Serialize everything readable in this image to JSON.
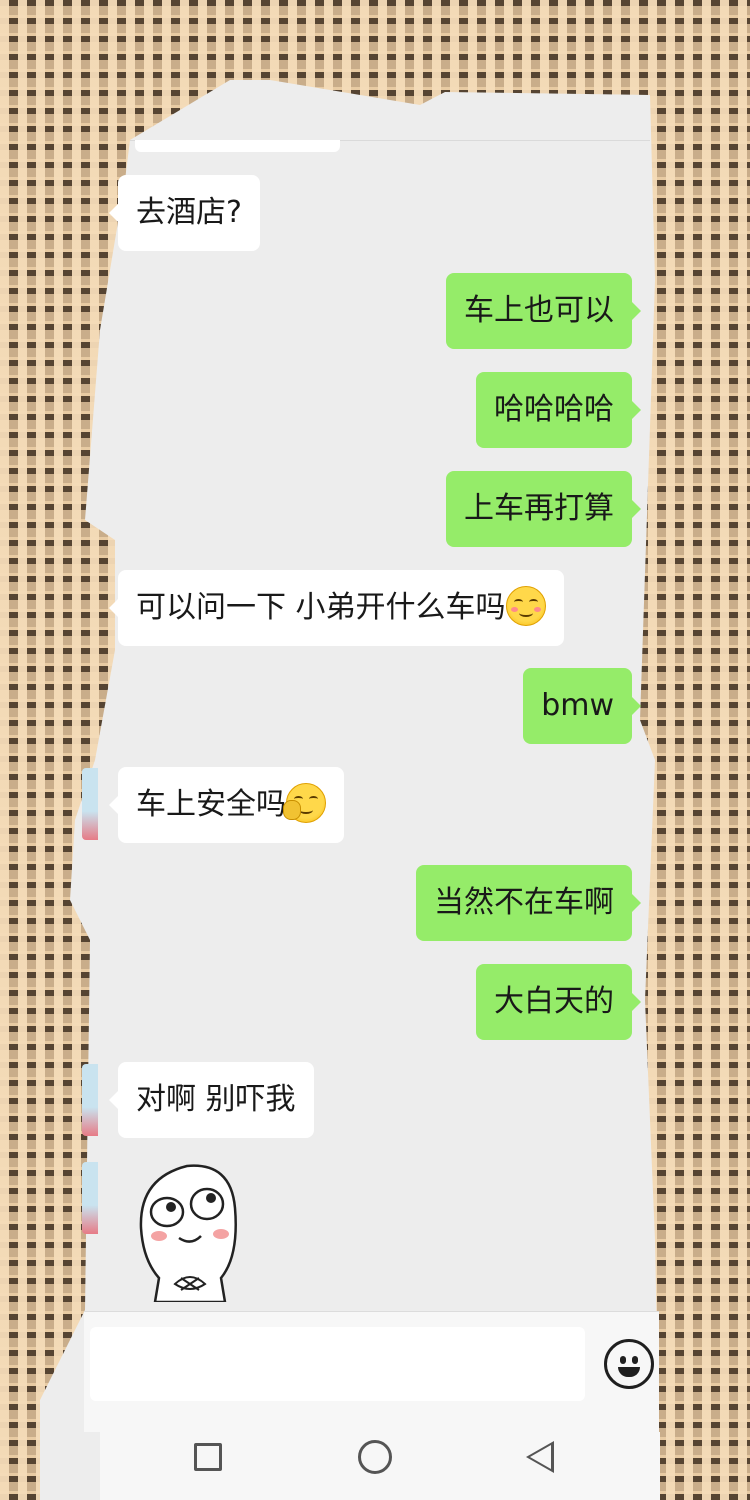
{
  "messages": [
    {
      "side": "in",
      "text": "去酒店?"
    },
    {
      "side": "out",
      "text": "车上也可以"
    },
    {
      "side": "out",
      "text": "哈哈哈哈"
    },
    {
      "side": "out",
      "text": "上车再打算"
    },
    {
      "side": "in",
      "text": "可以问一下 小弟开什么车吗",
      "emoji": "smirk-emoji"
    },
    {
      "side": "out",
      "text": "bmw"
    },
    {
      "side": "in",
      "text": "车上安全吗",
      "emoji": "facepalm-emoji"
    },
    {
      "side": "out",
      "text": "当然不在车啊"
    },
    {
      "side": "out",
      "text": "大白天的"
    },
    {
      "side": "in",
      "text": "对啊 别吓我"
    },
    {
      "side": "in",
      "sticker": "meme-face-sticker"
    }
  ],
  "input": {
    "value": ""
  },
  "icons": {
    "emoji_button": "smiley-face-icon",
    "nav": [
      "square-recent-icon",
      "circle-home-icon",
      "triangle-back-icon"
    ]
  },
  "colors": {
    "outgoing": "#95ec69",
    "incoming": "#ffffff",
    "background": "#ededed"
  }
}
